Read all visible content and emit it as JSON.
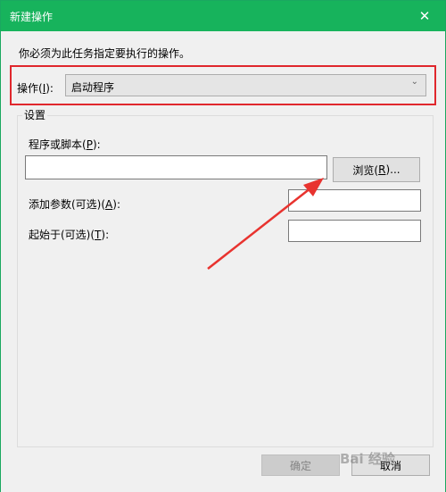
{
  "window": {
    "title": "新建操作",
    "close_glyph": "✕"
  },
  "instruction": "你必须为此任务指定要执行的操作。",
  "action": {
    "label_pre": "操作(",
    "label_key": "I",
    "label_post": "):",
    "value": "启动程序"
  },
  "settings": {
    "legend": "设置",
    "program": {
      "label_pre": "程序或脚本(",
      "label_key": "P",
      "label_post": "):",
      "value": "",
      "browse_pre": "浏览(",
      "browse_key": "R",
      "browse_post": ")..."
    },
    "args": {
      "label_pre": "添加参数(可选)(",
      "label_key": "A",
      "label_post": "):",
      "value": ""
    },
    "start_in": {
      "label_pre": "起始于(可选)(",
      "label_key": "T",
      "label_post": "):",
      "value": ""
    }
  },
  "buttons": {
    "ok": "确定",
    "cancel": "取消"
  },
  "watermark": "Bai 经验",
  "colors": {
    "titlebar": "#17b35c",
    "highlight": "#e0272d"
  }
}
